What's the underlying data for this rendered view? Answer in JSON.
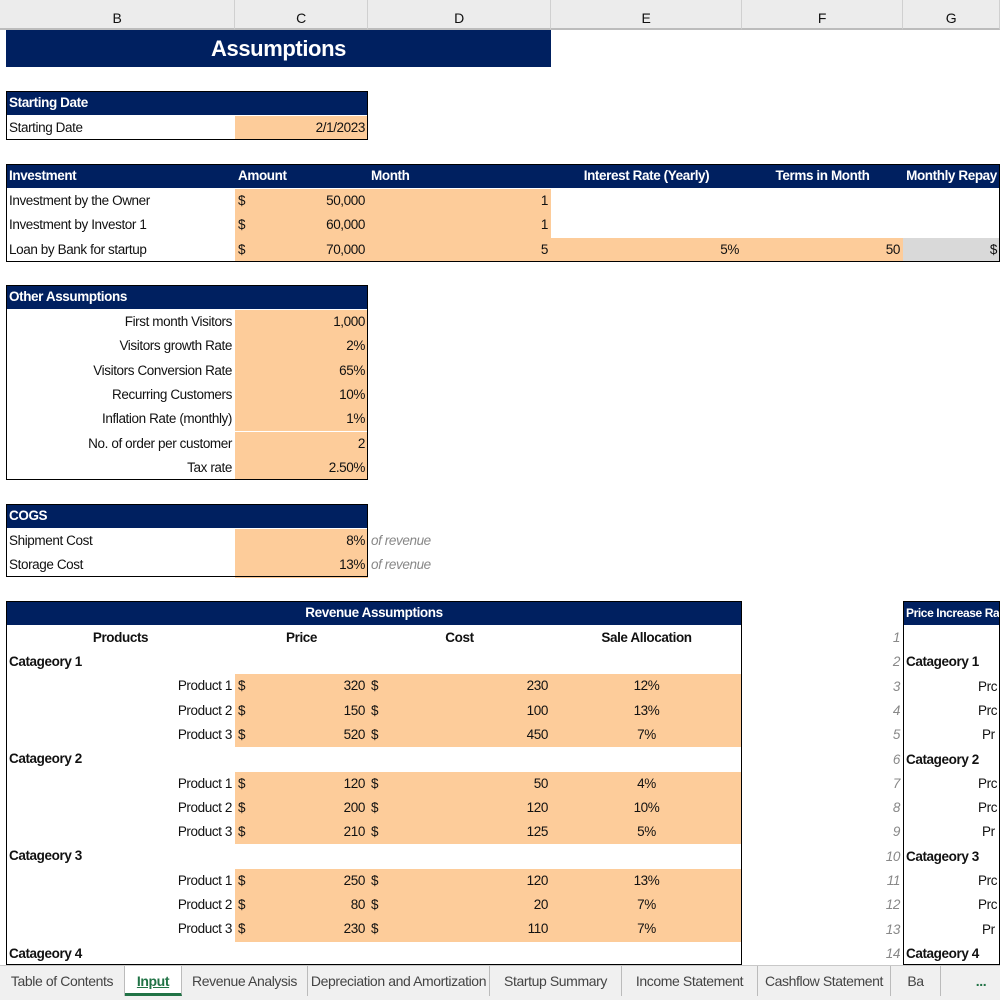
{
  "columns": [
    "B",
    "C",
    "D",
    "E",
    "F",
    "G"
  ],
  "title": "Assumptions",
  "starting_date": {
    "header": "Starting Date",
    "label": "Starting Date",
    "value": "2/1/2023"
  },
  "investment": {
    "headers": [
      "Investment",
      "Amount",
      "Month",
      "Interest Rate (Yearly)",
      "Terms in Month",
      "Monthly Repay"
    ],
    "rows": [
      {
        "label": "Investment by the Owner",
        "currency": "$",
        "amount": "50,000",
        "month": "1",
        "rate": "",
        "terms": "",
        "repay": ""
      },
      {
        "label": "Investment by Investor 1",
        "currency": "$",
        "amount": "60,000",
        "month": "1",
        "rate": "",
        "terms": "",
        "repay": ""
      },
      {
        "label": "Loan by Bank for startup",
        "currency": "$",
        "amount": "70,000",
        "month": "5",
        "rate": "5%",
        "terms": "50",
        "repay": "$"
      }
    ]
  },
  "other": {
    "header": "Other Assumptions",
    "rows": [
      {
        "label": "First month Visitors",
        "value": "1,000"
      },
      {
        "label": "Visitors growth Rate",
        "value": "2%"
      },
      {
        "label": "Visitors Conversion Rate",
        "value": "65%"
      },
      {
        "label": "Recurring Customers",
        "value": "10%"
      },
      {
        "label": "Inflation Rate (monthly)",
        "value": "1%"
      },
      {
        "label": "No. of order per customer",
        "value": "2"
      },
      {
        "label": "Tax rate",
        "value": "2.50%"
      }
    ]
  },
  "cogs": {
    "header": "COGS",
    "note": "of revenue",
    "rows": [
      {
        "label": "Shipment Cost",
        "value": "8%"
      },
      {
        "label": "Storage Cost",
        "value": "13%"
      }
    ]
  },
  "revenue": {
    "header": "Revenue Assumptions",
    "columns": [
      "Products",
      "Price",
      "Cost",
      "Sale Allocation"
    ],
    "categories": [
      {
        "name": "Catageory 1",
        "products": [
          {
            "name": "Product 1",
            "price": "320",
            "cost": "230",
            "alloc": "12%"
          },
          {
            "name": "Product 2",
            "price": "150",
            "cost": "100",
            "alloc": "13%"
          },
          {
            "name": "Product 3",
            "price": "520",
            "cost": "450",
            "alloc": "7%"
          }
        ]
      },
      {
        "name": "Catageory 2",
        "products": [
          {
            "name": "Product 1",
            "price": "120",
            "cost": "50",
            "alloc": "4%"
          },
          {
            "name": "Product 2",
            "price": "200",
            "cost": "120",
            "alloc": "10%"
          },
          {
            "name": "Product 3",
            "price": "210",
            "cost": "125",
            "alloc": "5%"
          }
        ]
      },
      {
        "name": "Catageory 3",
        "products": [
          {
            "name": "Product 1",
            "price": "250",
            "cost": "120",
            "alloc": "13%"
          },
          {
            "name": "Product 2",
            "price": "80",
            "cost": "20",
            "alloc": "7%"
          },
          {
            "name": "Product 3",
            "price": "230",
            "cost": "110",
            "alloc": "7%"
          }
        ]
      },
      {
        "name": "Catageory 4",
        "products": []
      }
    ]
  },
  "price_increase": {
    "header": "Price Increase Rat",
    "rows": [
      {
        "n": "1",
        "label": "",
        "type": "blank"
      },
      {
        "n": "2",
        "label": "Catageory 1",
        "type": "cat"
      },
      {
        "n": "3",
        "label": "Prc",
        "type": "p"
      },
      {
        "n": "4",
        "label": "Prc",
        "type": "p"
      },
      {
        "n": "5",
        "label": "Pr",
        "type": "p"
      },
      {
        "n": "6",
        "label": "Catageory 2",
        "type": "cat"
      },
      {
        "n": "7",
        "label": "Prc",
        "type": "p"
      },
      {
        "n": "8",
        "label": "Prc",
        "type": "p"
      },
      {
        "n": "9",
        "label": "Pr",
        "type": "p"
      },
      {
        "n": "10",
        "label": "Catageory 3",
        "type": "cat"
      },
      {
        "n": "11",
        "label": "Prc",
        "type": "p"
      },
      {
        "n": "12",
        "label": "Prc",
        "type": "p"
      },
      {
        "n": "13",
        "label": "Pr",
        "type": "p"
      },
      {
        "n": "14",
        "label": "Catageory 4",
        "type": "cat"
      }
    ]
  },
  "tabs": [
    {
      "label": "Table of Contents"
    },
    {
      "label": "Input",
      "active": true
    },
    {
      "label": "Revenue Analysis"
    },
    {
      "label": "Depreciation and Amortization"
    },
    {
      "label": "Startup Summary"
    },
    {
      "label": "Income Statement"
    },
    {
      "label": "Cashflow Statement"
    },
    {
      "label": "Ba"
    }
  ],
  "tabs_more": "...",
  "colors": {
    "header": "#002060",
    "input": "#fdcc9a",
    "computed": "#d9d9d9",
    "active_tab": "#217346"
  }
}
